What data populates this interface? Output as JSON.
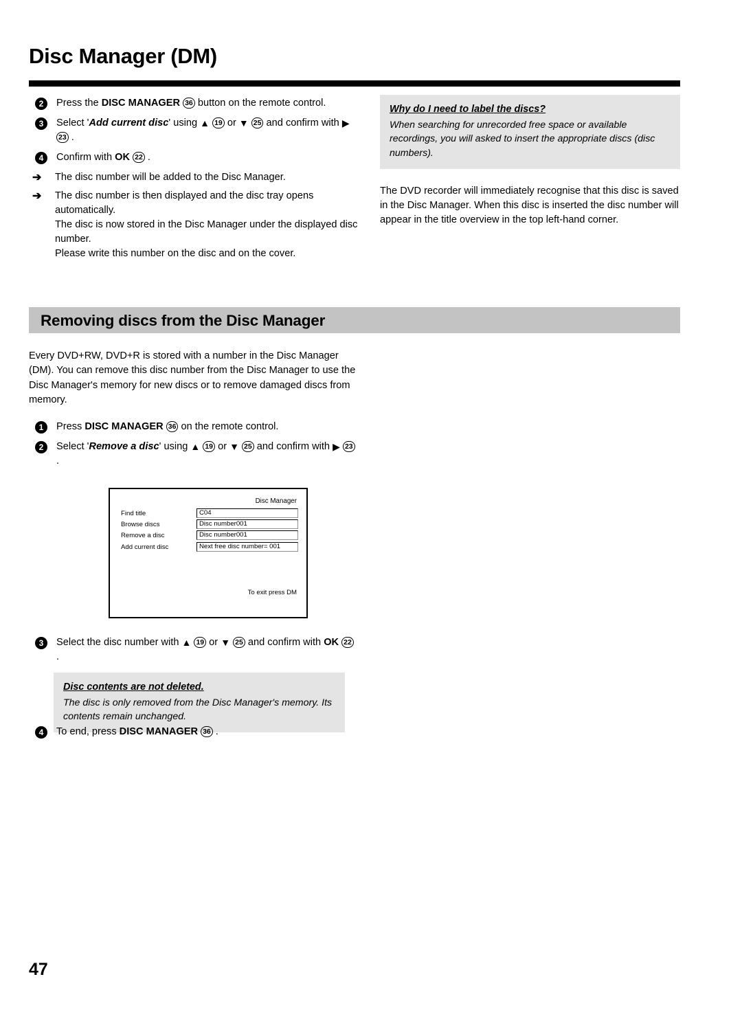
{
  "page": {
    "title": "Disc Manager (DM)",
    "number": "47"
  },
  "section_one": {
    "steps": [
      {
        "num": "2",
        "parts": [
          {
            "t": "Press the  ",
            "s": "normal"
          },
          {
            "t": "DISC MANAGER",
            "s": "bold"
          },
          {
            "t": "36",
            "s": "ref"
          },
          {
            "t": " button on the remote control.",
            "s": "normal"
          }
        ]
      },
      {
        "num": "3",
        "parts": [
          {
            "t": "Select '",
            "s": "normal"
          },
          {
            "t": "Add current disc",
            "s": "bolditalic"
          },
          {
            "t": "' using  ",
            "s": "normal"
          },
          {
            "t": "▲",
            "s": "tri"
          },
          {
            "t": "19",
            "s": "ref"
          },
          {
            "t": " or  ",
            "s": "normal"
          },
          {
            "t": "▼",
            "s": "tri"
          },
          {
            "t": "25",
            "s": "ref"
          },
          {
            "t": " and confirm with  ",
            "s": "normal"
          },
          {
            "t": "▶",
            "s": "tri"
          },
          {
            "t": "23",
            "s": "ref"
          },
          {
            "t": " .",
            "s": "normal"
          }
        ]
      },
      {
        "num": "4",
        "parts": [
          {
            "t": "Confirm with  ",
            "s": "normal"
          },
          {
            "t": "OK",
            "s": "bold"
          },
          {
            "t": "22",
            "s": "ref"
          },
          {
            "t": " .",
            "s": "normal"
          }
        ]
      }
    ],
    "sub_bullets": [
      "The disc number will be added to the Disc Manager.",
      "The disc number is then displayed and the disc tray opens automatically.\nThe disc is now stored in the Disc Manager under the displayed disc number.\nPlease write this number on the disc and on the cover."
    ]
  },
  "tip_box": {
    "heading": "Why do I need to label the discs?",
    "body": "When searching for unrecorded free space or available recordings, you will asked to insert the appropriate discs (disc numbers)."
  },
  "right_paragraph": "The DVD recorder will immediately recognise that this disc is saved in the Disc Manager. When this disc is inserted the disc number will appear in the title overview in the top left-hand corner.",
  "section_two": {
    "heading": "Removing discs from the Disc Manager",
    "intro": "Every DVD+RW, DVD+R is stored with a number in the Disc Manager (DM). You can remove this disc number from the Disc Manager to use the Disc Manager's memory for new discs or to remove damaged discs from memory.",
    "steps": [
      {
        "num": "1",
        "parts": [
          {
            "t": "Press  ",
            "s": "normal"
          },
          {
            "t": "DISC MANAGER",
            "s": "bold"
          },
          {
            "t": "36",
            "s": "ref"
          },
          {
            "t": " on the remote control.",
            "s": "normal"
          }
        ]
      },
      {
        "num": "2",
        "parts": [
          {
            "t": "Select '",
            "s": "normal"
          },
          {
            "t": "Remove a disc",
            "s": "bolditalic"
          },
          {
            "t": "' using  ",
            "s": "normal"
          },
          {
            "t": "▲",
            "s": "tri"
          },
          {
            "t": "19",
            "s": "ref"
          },
          {
            "t": " or  ",
            "s": "normal"
          },
          {
            "t": "▼",
            "s": "tri"
          },
          {
            "t": "25",
            "s": "ref"
          },
          {
            "t": " and confirm with  ",
            "s": "normal"
          },
          {
            "t": "▶",
            "s": "tri"
          },
          {
            "t": "23",
            "s": "ref"
          },
          {
            "t": " .",
            "s": "normal"
          }
        ]
      },
      {
        "num": "3",
        "parts": [
          {
            "t": "Select the disc number with  ",
            "s": "normal"
          },
          {
            "t": "▲",
            "s": "tri"
          },
          {
            "t": "19",
            "s": "ref"
          },
          {
            "t": " or  ",
            "s": "normal"
          },
          {
            "t": "▼",
            "s": "tri"
          },
          {
            "t": "25",
            "s": "ref"
          },
          {
            "t": " and confirm with ",
            "s": "normal"
          },
          {
            "t": "OK",
            "s": "bold"
          },
          {
            "t": "22",
            "s": "ref"
          },
          {
            "t": " .",
            "s": "normal"
          }
        ]
      },
      {
        "num": "4",
        "parts": [
          {
            "t": "To end, press  ",
            "s": "normal"
          },
          {
            "t": "DISC MANAGER",
            "s": "bold"
          },
          {
            "t": "36",
            "s": "ref"
          },
          {
            "t": " .",
            "s": "normal"
          }
        ]
      }
    ],
    "note_box": {
      "heading": "Disc contents are not deleted.",
      "body": "The disc is only removed from the Disc Manager's memory. Its contents remain unchanged."
    }
  },
  "tv_screen": {
    "title": "Disc Manager",
    "exit_hint": "To exit press DM",
    "rows": [
      {
        "label": "Find title",
        "value": "C04"
      },
      {
        "label": "Browse discs",
        "value": "Disc number001"
      },
      {
        "label": "Remove a disc",
        "value": "Disc number001"
      },
      {
        "label": "Add current disc",
        "value": "Next free disc number= 001"
      }
    ]
  }
}
